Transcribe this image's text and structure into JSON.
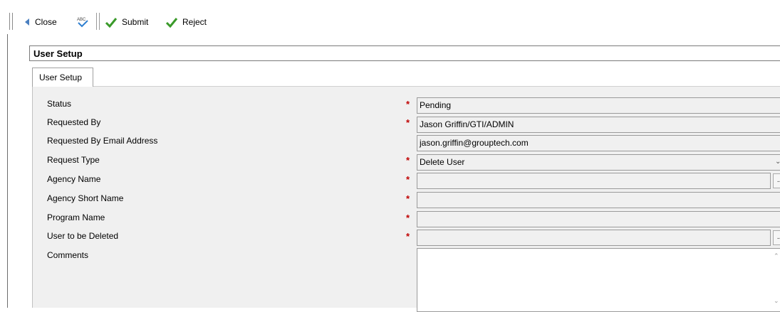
{
  "toolbar": {
    "close_label": "Close",
    "submit_label": "Submit",
    "reject_label": "Reject"
  },
  "panel": {
    "title": "User Setup"
  },
  "tabs": [
    {
      "label": "User Setup"
    }
  ],
  "form": {
    "fields": [
      {
        "label": "Status",
        "value": "Pending",
        "required": true
      },
      {
        "label": "Requested By",
        "value": "Jason Griffin/GTI/ADMIN",
        "required": true
      },
      {
        "label": "Requested By Email Address",
        "value": "jason.griffin@grouptech.com",
        "required": false
      },
      {
        "label": "Request Type",
        "value": "Delete User",
        "required": true
      },
      {
        "label": "Agency Name",
        "value": "",
        "required": true
      },
      {
        "label": "Agency Short Name",
        "value": "",
        "required": true
      },
      {
        "label": "Program Name",
        "value": "",
        "required": true
      },
      {
        "label": "User to be Deleted",
        "value": "",
        "required": true
      },
      {
        "label": "Comments",
        "value": "",
        "required": false
      }
    ],
    "required_marker": "*",
    "lookup_button": "..."
  },
  "colors": {
    "required": "#c00000",
    "check": "#3a9a2a",
    "spell": "#2f7fd0"
  },
  "icons": [
    "back-arrow-icon",
    "spellcheck-icon",
    "checkmark-icon"
  ]
}
